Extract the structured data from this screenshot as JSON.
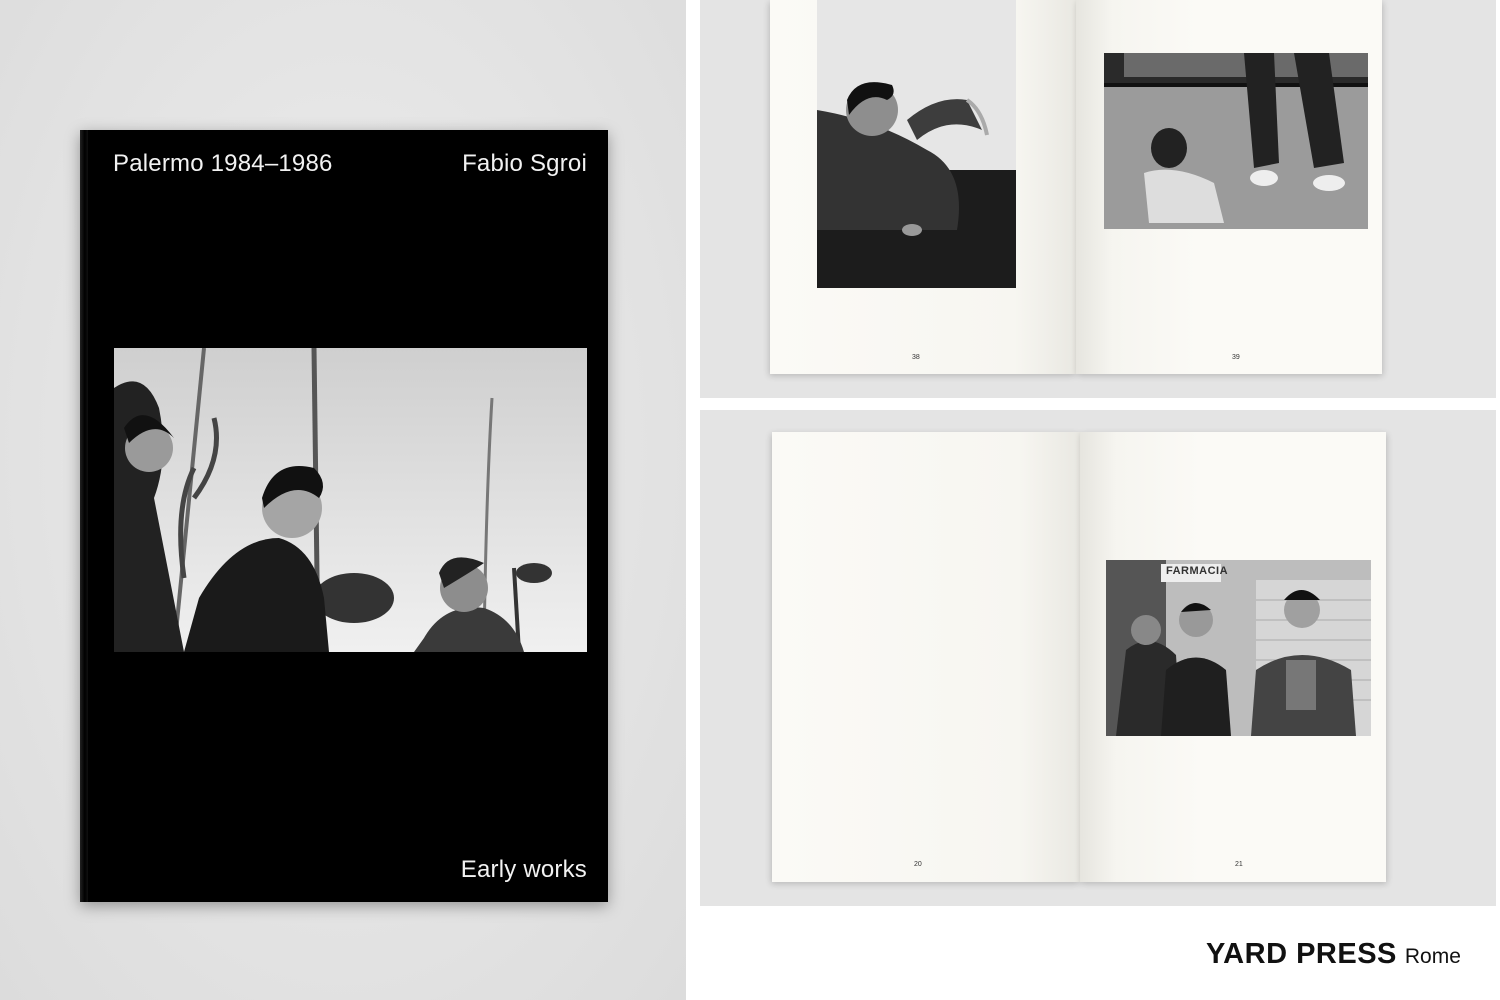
{
  "cover": {
    "title": "Palermo 1984–1986",
    "author": "Fabio Sgroi",
    "subtitle": "Early works"
  },
  "spread_top": {
    "left_page_number": "38",
    "right_page_number": "39"
  },
  "spread_bottom": {
    "left_page_number": "20",
    "right_page_number": "21",
    "shop_sign": "FARMACIA"
  },
  "publisher": {
    "name": "YARD PRESS",
    "city": "Rome"
  },
  "colors": {
    "cover": "#000000",
    "paper": "#fbfaf6",
    "background": "#e4e4e4"
  }
}
